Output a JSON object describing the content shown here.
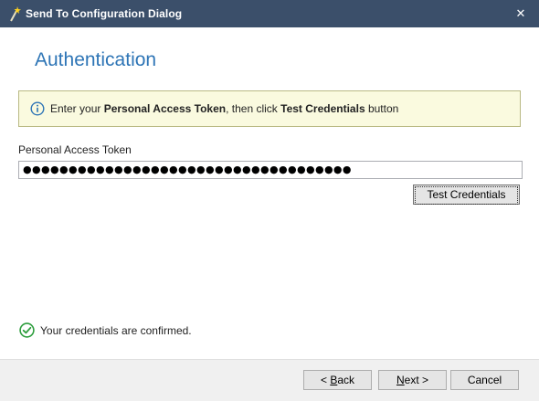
{
  "window": {
    "title": "Send To Configuration Dialog",
    "close_glyph": "✕",
    "icon": "wand-icon"
  },
  "page": {
    "heading": "Authentication"
  },
  "info": {
    "icon": "info-icon",
    "text_before": "Enter your ",
    "bold1": "Personal Access Token",
    "text_middle": ", then click ",
    "bold2": "Test Credentials",
    "text_after": " button"
  },
  "token": {
    "label": "Personal Access Token",
    "value": "●●●●●●●●●●●●●●●●●●●●●●●●●●●●●●●●●●●●"
  },
  "test_button": {
    "label": "Test Credentials"
  },
  "status": {
    "icon": "check-circle-icon",
    "text": "Your credentials are confirmed.",
    "color": "#2e9e3e"
  },
  "footer": {
    "back": {
      "prefix": "< ",
      "accel": "B",
      "rest": "ack"
    },
    "next": {
      "accel": "N",
      "rest": "ext",
      "suffix": " >"
    },
    "cancel": "Cancel"
  },
  "colors": {
    "titlebar": "#3b4f6a",
    "heading": "#2e75b6",
    "info_bg": "#fafadf",
    "info_border": "#b9b983"
  }
}
